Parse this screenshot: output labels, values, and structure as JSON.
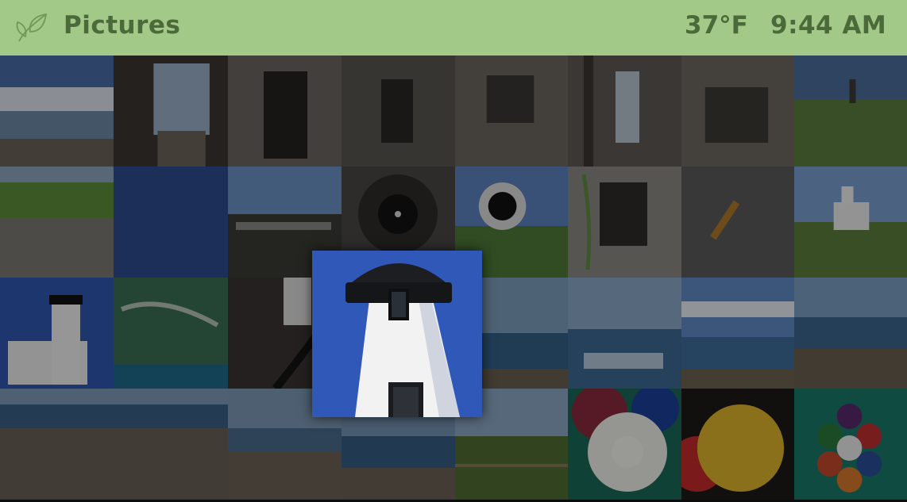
{
  "header": {
    "title": "Pictures",
    "temperature": "37°F",
    "time": "9:44 AM",
    "logo_icon": "leaf-icon",
    "bg_color": "#a3c988",
    "text_color": "#4a6a3a"
  },
  "gallery": {
    "rows": 4,
    "columns": 8,
    "focused_tile": {
      "row": 3,
      "column": 3,
      "subject": "lighthouse-closeup"
    },
    "tiles": [
      "shoreline-clouds",
      "bunker-doorway",
      "bunker-stairway",
      "concrete-corridor",
      "concrete-room",
      "pillared-hallway",
      "bunker-room",
      "field-tower",
      "grass-lawn",
      "blue-sky",
      "cannon-mount",
      "tunnel-rings",
      "cannon-muzzle",
      "vine-doorway",
      "caterpillar-asphalt",
      "lighthouse-distant",
      "lighthouse-house",
      "aerial-map",
      "spiral-stair",
      "sea-horizon",
      "sea-horizon",
      "sea-sunlight",
      "sea-clouds",
      "beach-rocks",
      "rocky-beach",
      "rocky-beach",
      "beach-driftwood",
      "beach-water",
      "fence-field",
      "billiard-9",
      "billiard-yellow",
      "billiard-rack"
    ]
  }
}
